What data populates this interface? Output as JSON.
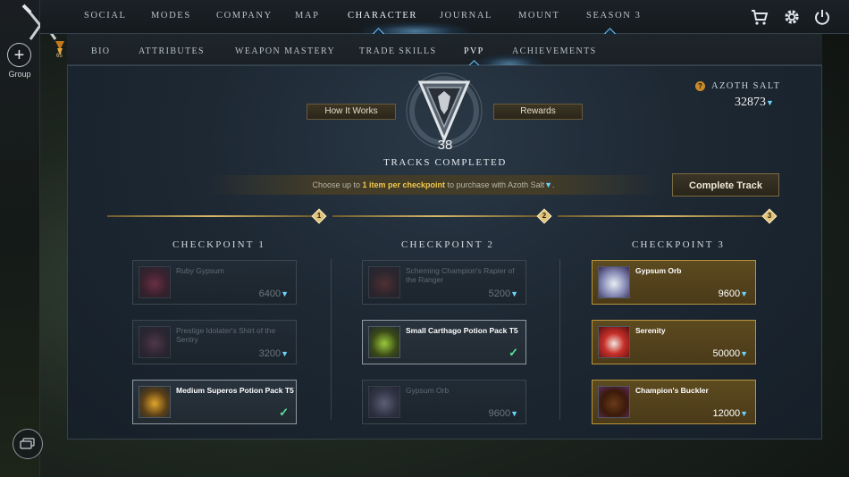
{
  "topnav": {
    "items": [
      "SOCIAL",
      "MODES",
      "COMPANY",
      "MAP",
      "CHARACTER",
      "JOURNAL",
      "MOUNT",
      "SEASON 3"
    ],
    "active": "CHARACTER",
    "icons": [
      "cart-icon",
      "gear-icon",
      "power-icon"
    ]
  },
  "left": {
    "group_symbol": "+",
    "group_label": "Group",
    "level": "65"
  },
  "subnav": {
    "items": [
      "BIO",
      "ATTRIBUTES",
      "WEAPON MASTERY",
      "TRADE SKILLS",
      "PVP",
      "ACHIEVEMENTS"
    ],
    "active": "PVP"
  },
  "header": {
    "how_it_works": "How It Works",
    "rewards": "Rewards",
    "tracks_count": "38",
    "tracks_label": "TRACKS COMPLETED"
  },
  "azoth": {
    "help": "?",
    "label": "AZOTH SALT",
    "value": "32873"
  },
  "info": {
    "pre": "Choose up to ",
    "highlight": "1 item per checkpoint",
    "post": " to purchase with Azoth Salt",
    "end": "."
  },
  "complete_track_label": "Complete Track",
  "track_nodes": [
    "1",
    "2",
    "3"
  ],
  "checkpoints": [
    {
      "title": "CHECKPOINT 1",
      "items": [
        {
          "name": "Ruby Gypsum",
          "price": "6400",
          "state": "dim",
          "icon": "ruby-gypsum-icon"
        },
        {
          "name": "Prestige Idolater's Shirt of the Sentry",
          "price": "3200",
          "state": "dim",
          "icon": "shirt-icon"
        },
        {
          "name": "Medium Superos Potion Pack T5",
          "price": "",
          "state": "owned",
          "icon": "potion-pack-icon"
        }
      ]
    },
    {
      "title": "CHECKPOINT 2",
      "items": [
        {
          "name": "Scheming Champion's Rapier of the Ranger",
          "price": "5200",
          "state": "dim",
          "icon": "rapier-icon"
        },
        {
          "name": "Small Carthago Potion Pack T5",
          "price": "",
          "state": "owned",
          "icon": "potion-pack-icon"
        },
        {
          "name": "Gypsum Orb",
          "price": "9600",
          "state": "dim",
          "icon": "gypsum-orb-icon"
        }
      ]
    },
    {
      "title": "CHECKPOINT 3",
      "items": [
        {
          "name": "Gypsum Orb",
          "price": "9600",
          "state": "gold",
          "icon": "gypsum-orb-icon"
        },
        {
          "name": "Serenity",
          "price": "50000",
          "state": "gold",
          "icon": "axe-icon"
        },
        {
          "name": "Champion's Buckler",
          "price": "12000",
          "state": "gold",
          "icon": "buckler-icon"
        }
      ]
    }
  ],
  "colors": {
    "accent_blue": "#7cc9ff",
    "gold": "#d8b968",
    "owned_check": "#57e39a"
  }
}
